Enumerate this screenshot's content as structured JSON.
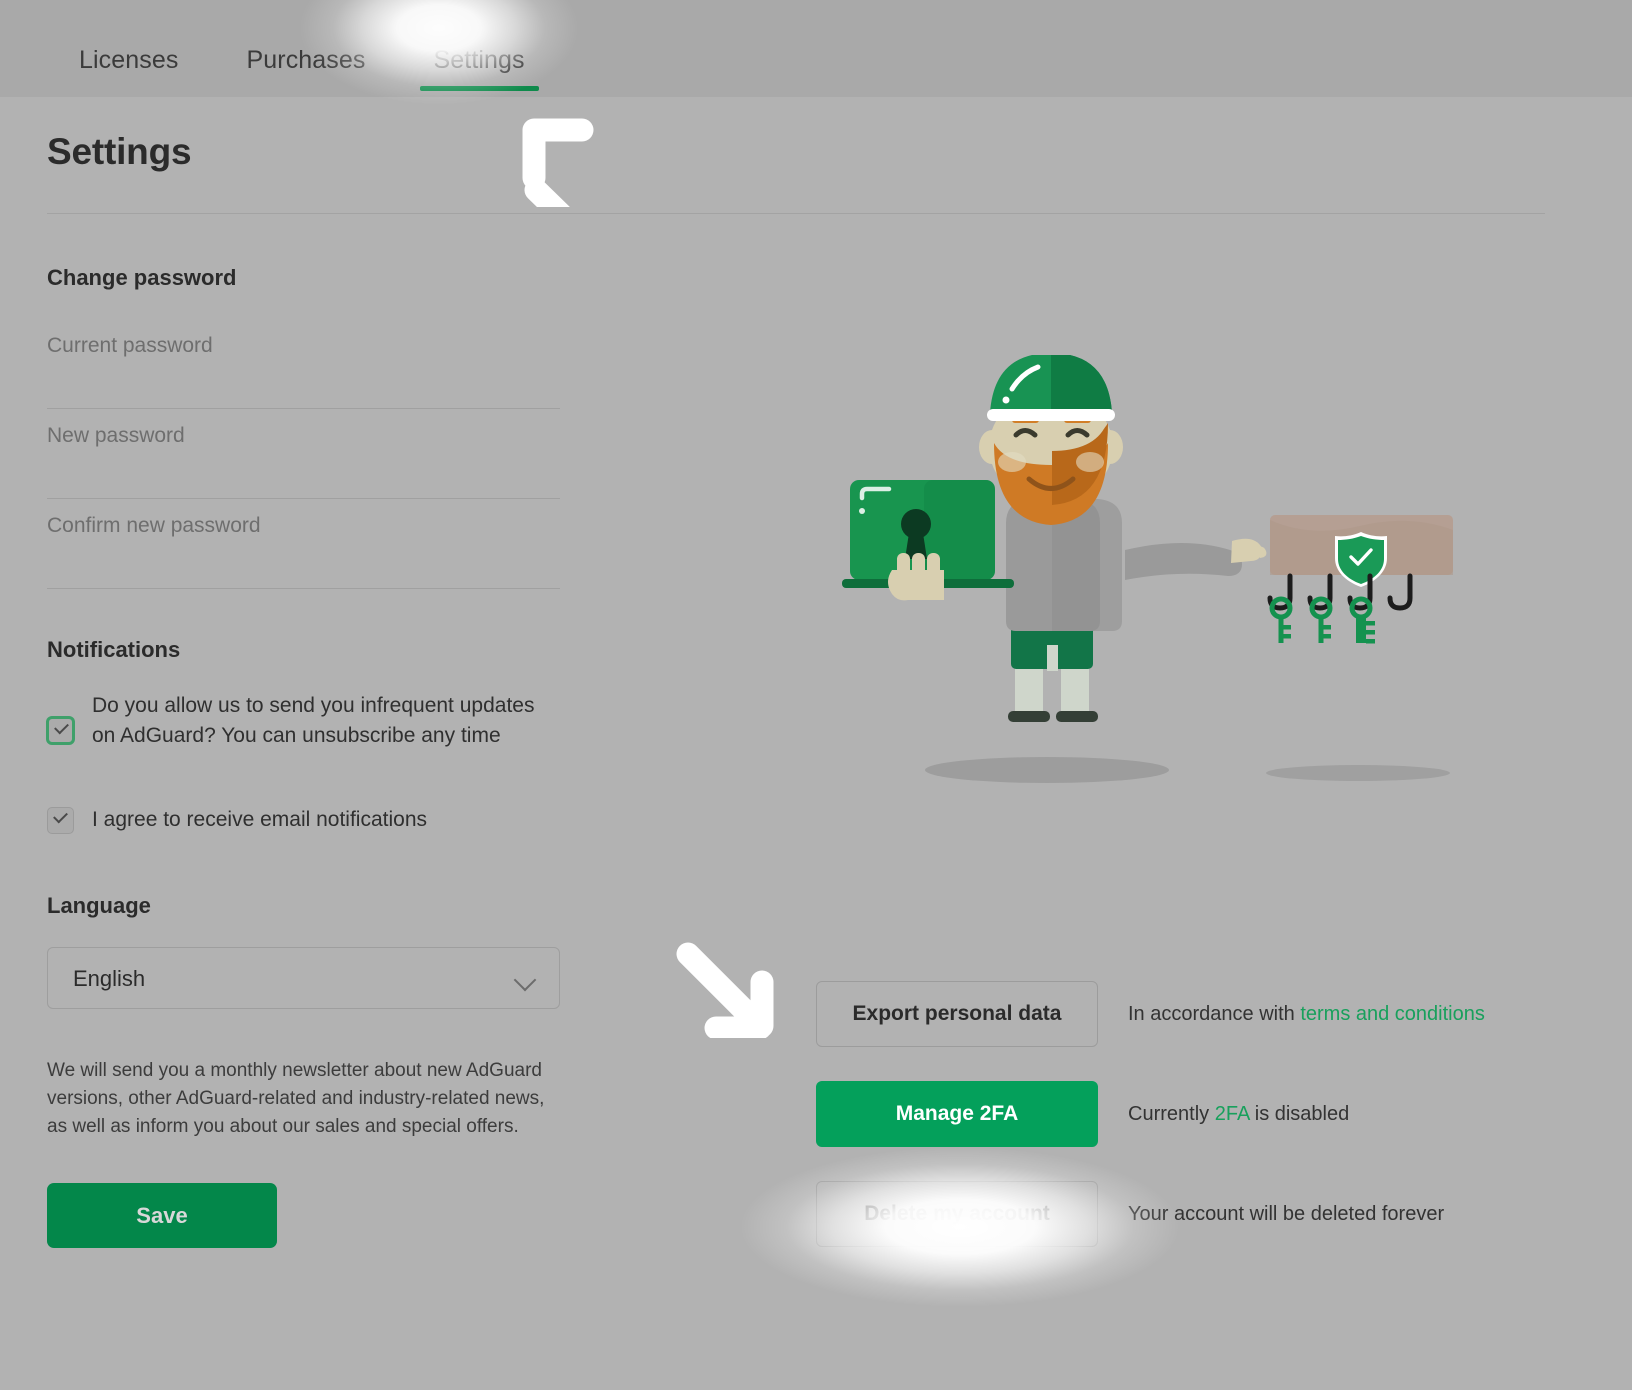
{
  "nav": {
    "tabs": [
      {
        "label": "Licenses",
        "active": false
      },
      {
        "label": "Purchases",
        "active": false
      },
      {
        "label": "Settings",
        "active": true
      }
    ]
  },
  "page": {
    "title": "Settings"
  },
  "change_password": {
    "heading": "Change password",
    "fields": [
      {
        "name": "current-password",
        "placeholder": "Current password",
        "value": ""
      },
      {
        "name": "new-password",
        "placeholder": "New password",
        "value": ""
      },
      {
        "name": "confirm-new-password",
        "placeholder": "Confirm new password",
        "value": ""
      }
    ]
  },
  "notifications": {
    "heading": "Notifications",
    "checkboxes": [
      {
        "label": "Do you allow us to send you infrequent updates on AdGuard? You can unsubscribe any time",
        "checked": true,
        "focused": true
      },
      {
        "label": "I agree to receive email notifications",
        "checked": true,
        "focused": false
      }
    ]
  },
  "language": {
    "heading": "Language",
    "selected": "English",
    "options": [
      "English"
    ]
  },
  "newsletter_note": "We will send you a monthly newsletter about new AdGuard versions, other AdGuard-related and industry-related news, as well as inform you about our sales and special offers.",
  "save_button": "Save",
  "account_actions": [
    {
      "button": "Export personal data",
      "style": "outline",
      "note_before": "In accordance with ",
      "note_link": "terms and conditions",
      "note_after": ""
    },
    {
      "button": "Manage 2FA",
      "style": "green",
      "note_before": "Currently ",
      "note_link": "2FA",
      "note_after": " is disabled"
    },
    {
      "button": "Delete my account",
      "style": "outline",
      "note_before": "Your account will be deleted forever",
      "note_link": "",
      "note_after": ""
    }
  ],
  "cursors": [
    {
      "name": "arrow-up-left",
      "direction": "up-left"
    },
    {
      "name": "arrow-down-right",
      "direction": "down-right"
    }
  ],
  "illustration": {
    "name": "adguard-mascot-with-keys",
    "description": "AdGuard mascot holding a laptop with a keyhole, pointing at a wooden key rack with a shield logo and hanging keys"
  },
  "colors": {
    "brand_green": "#03874a",
    "accent_green": "#04a05b",
    "link_green": "#18a05c",
    "tab_underline": "#0e8a4b",
    "page_bg": "#b2b2b2",
    "nav_bg": "#a9a9a9",
    "text_primary": "#2b2b2b",
    "text_muted": "#6e6e6e"
  }
}
